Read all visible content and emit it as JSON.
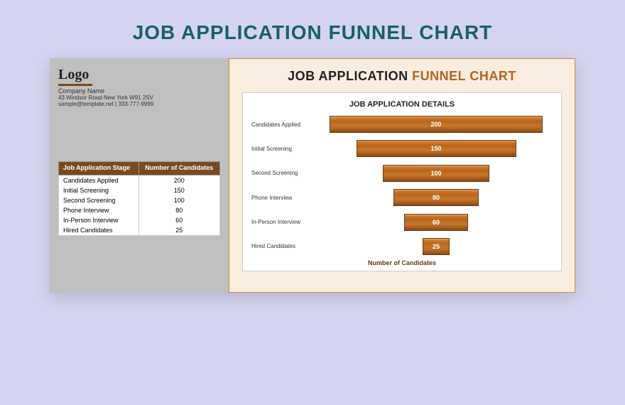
{
  "page_title": "JOB APPLICATION FUNNEL CHART",
  "left": {
    "logo": "Logo",
    "company": "Company Name",
    "address": "43 Windsor Road New York W91 2SV",
    "contact": "sample@template.net | 333-777-9999"
  },
  "table": {
    "head_stage": "Job Application Stage",
    "head_count": "Number of Candidates",
    "rows": [
      {
        "stage": "Candidates Applied",
        "count": "200"
      },
      {
        "stage": "Initial Screening",
        "count": "150"
      },
      {
        "stage": "Second Screening",
        "count": "100"
      },
      {
        "stage": "Phone Interview",
        "count": "80"
      },
      {
        "stage": "In-Person Interview",
        "count": "60"
      },
      {
        "stage": "Hired Candidates",
        "count": "25"
      }
    ]
  },
  "chart": {
    "title_a": "JOB APPLICATION ",
    "title_b": "FUNNEL CHART",
    "subtitle": "JOB APPLICATION DETAILS",
    "xlabel": "Number of Candidates"
  },
  "chart_data": {
    "type": "bar",
    "orientation": "funnel",
    "title": "JOB APPLICATION DETAILS",
    "xlabel": "Number of Candidates",
    "ylabel": "",
    "categories": [
      "Candidates Applied",
      "Initial Screening",
      "Second Screening",
      "Phone Interview",
      "In-Person Interview",
      "Hired Candidates"
    ],
    "values": [
      200,
      150,
      100,
      80,
      60,
      25
    ],
    "xlim": [
      0,
      200
    ]
  }
}
